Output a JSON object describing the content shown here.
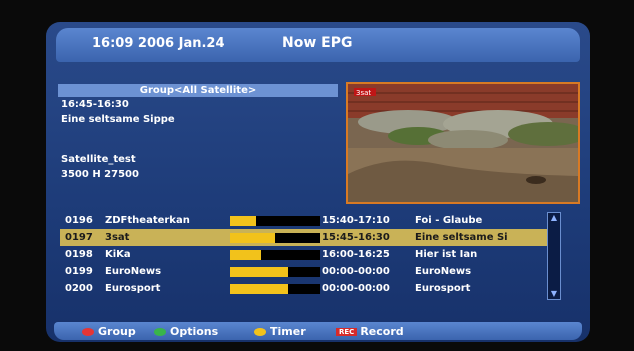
{
  "header": {
    "clock": "16:09 2006 Jan.24",
    "title": "Now EPG"
  },
  "info": {
    "group": "Group<All Satellite>",
    "time": "16:45-16:30",
    "program": "Eine seltsame Sippe",
    "satellite": "Satellite_test",
    "transponder": "3500 H 27500"
  },
  "preview": {
    "channel_logo": "3sat"
  },
  "channels": [
    {
      "num": "0196",
      "name": "ZDFtheaterkan",
      "progress": 0.29,
      "time": "15:40-17:10",
      "program": "Foi - Glaube"
    },
    {
      "num": "0197",
      "name": "3sat",
      "progress": 0.5,
      "time": "15:45-16:30",
      "program": "Eine seltsame Si"
    },
    {
      "num": "0198",
      "name": "KiKa",
      "progress": 0.34,
      "time": "16:00-16:25",
      "program": "Hier ist Ian"
    },
    {
      "num": "0199",
      "name": "EuroNews",
      "progress": 0.64,
      "time": "00:00-00:00",
      "program": "EuroNews"
    },
    {
      "num": "0200",
      "name": "Eurosport",
      "progress": 0.64,
      "time": "00:00-00:00",
      "program": "Eurosport"
    }
  ],
  "selected_index": 1,
  "footer": {
    "group": "Group",
    "options": "Options",
    "timer": "Timer",
    "rec_badge": "REC",
    "record": "Record"
  },
  "colors": {
    "accent": "#f2c21b",
    "selected_row": "#c9b257",
    "header": "#4a74c0"
  }
}
